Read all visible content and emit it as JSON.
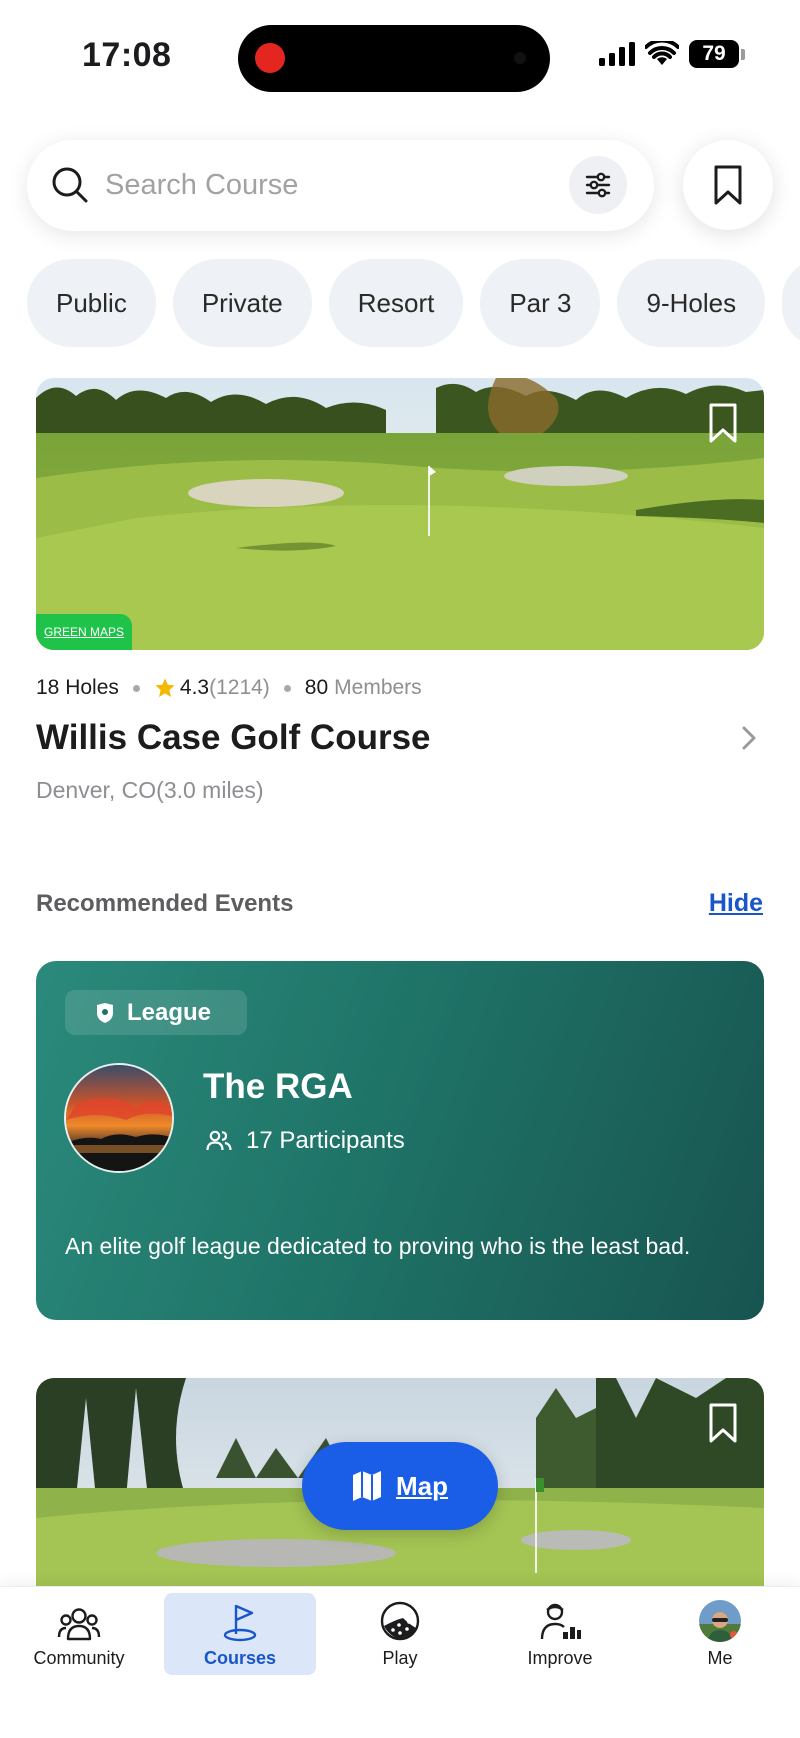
{
  "status_bar": {
    "time": "17:08",
    "battery": "79"
  },
  "search": {
    "placeholder": "Search Course",
    "value": ""
  },
  "filters": [
    "Public",
    "Private",
    "Resort",
    "Par 3",
    "9-Holes"
  ],
  "course": {
    "image_badge": "GREEN MAPS",
    "holes": "18 Holes",
    "rating": "4.3",
    "reviews": "(1214)",
    "members_count": "80",
    "members_label": "Members",
    "name": "Willis Case Golf Course",
    "location": "Denver, CO(3.0 miles)"
  },
  "events_section": {
    "title": "Recommended Events",
    "hide_label": "Hide",
    "event": {
      "badge": "League",
      "name": "The RGA",
      "participants": "17 Participants",
      "description": "An elite golf league dedicated to proving who is the least bad."
    }
  },
  "map_button": {
    "label": "Map"
  },
  "bottom_nav": [
    {
      "label": "Community",
      "icon": "community-icon",
      "active": false
    },
    {
      "label": "Courses",
      "icon": "flag-icon",
      "active": true
    },
    {
      "label": "Play",
      "icon": "golf-ball-icon",
      "active": false
    },
    {
      "label": "Improve",
      "icon": "improve-icon",
      "active": false
    },
    {
      "label": "Me",
      "icon": "avatar",
      "active": false
    }
  ],
  "colors": {
    "accent": "#1856c9",
    "map_button": "#1a5ee8",
    "event_card": "#1f7468",
    "green_badge": "#1fc34a",
    "nav_active_bg": "#dbe7f8"
  }
}
